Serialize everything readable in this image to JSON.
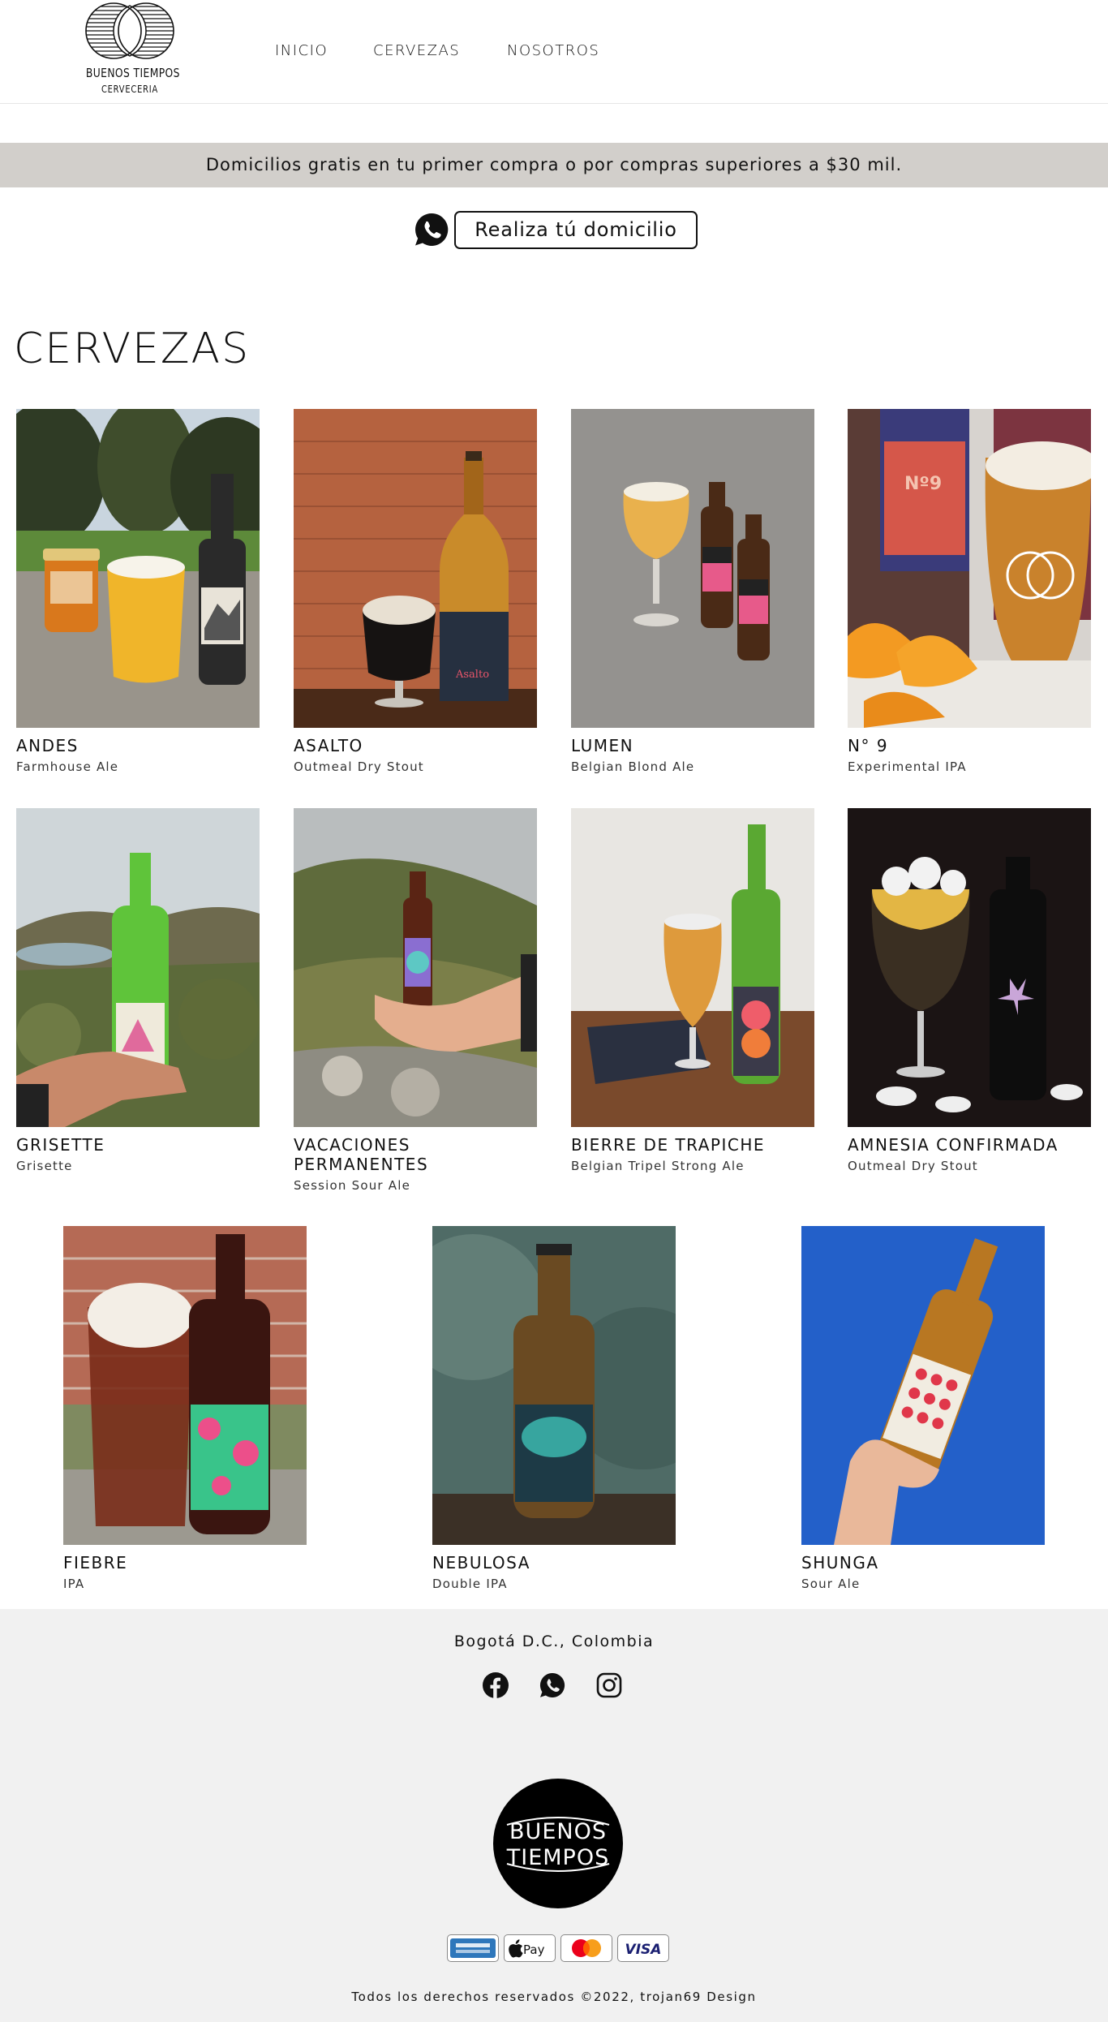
{
  "header": {
    "logo_name": "BUENOS TIEMPOS",
    "logo_sub": "CERVECERIA",
    "nav": [
      {
        "label": "INICIO"
      },
      {
        "label": "CERVEZAS"
      },
      {
        "label": "NOSOTROS"
      }
    ]
  },
  "announcement": "Domicilios gratis en tu primer compra o por compras superiores a $30 mil.",
  "order_button": "Realiza tú domicilio",
  "section_title": "CERVEZAS",
  "beers": [
    {
      "name": "ANDES",
      "style": "Farmhouse Ale"
    },
    {
      "name": "ASALTO",
      "style": "Outmeal Dry Stout"
    },
    {
      "name": "LUMEN",
      "style": "Belgian Blond Ale"
    },
    {
      "name": "N° 9",
      "style": "Experimental IPA"
    },
    {
      "name": "GRISETTE",
      "style": "Grisette"
    },
    {
      "name": "VACACIONES PERMANENTES",
      "style": "Session Sour Ale"
    },
    {
      "name": "BIERRE DE TRAPICHE",
      "style": "Belgian Tripel Strong Ale"
    },
    {
      "name": "AMNESIA CONFIRMADA",
      "style": "Outmeal Dry Stout"
    },
    {
      "name": "FIEBRE",
      "style": "IPA"
    },
    {
      "name": "NEBULOSA",
      "style": "Double IPA"
    },
    {
      "name": "SHUNGA",
      "style": "Sour Ale"
    }
  ],
  "image_text": {
    "asalto_label": "Asalto",
    "n9_label": "Nº9"
  },
  "footer": {
    "city": "Bogotá D.C., Colombia",
    "badge_line1": "BUENOS",
    "badge_line2": "TIEMPOS",
    "payment_methods": [
      "American Express",
      "Apple Pay",
      "Mastercard",
      "VISA"
    ],
    "applepay_text": "Pay",
    "visa_text": "VISA",
    "copyright": "Todos los derechos reservados ©2022, trojan69 Design"
  },
  "colors": {
    "announce_bg": "#d2cfcb",
    "footer_bg": "#f1f1f1",
    "text": "#111111"
  }
}
